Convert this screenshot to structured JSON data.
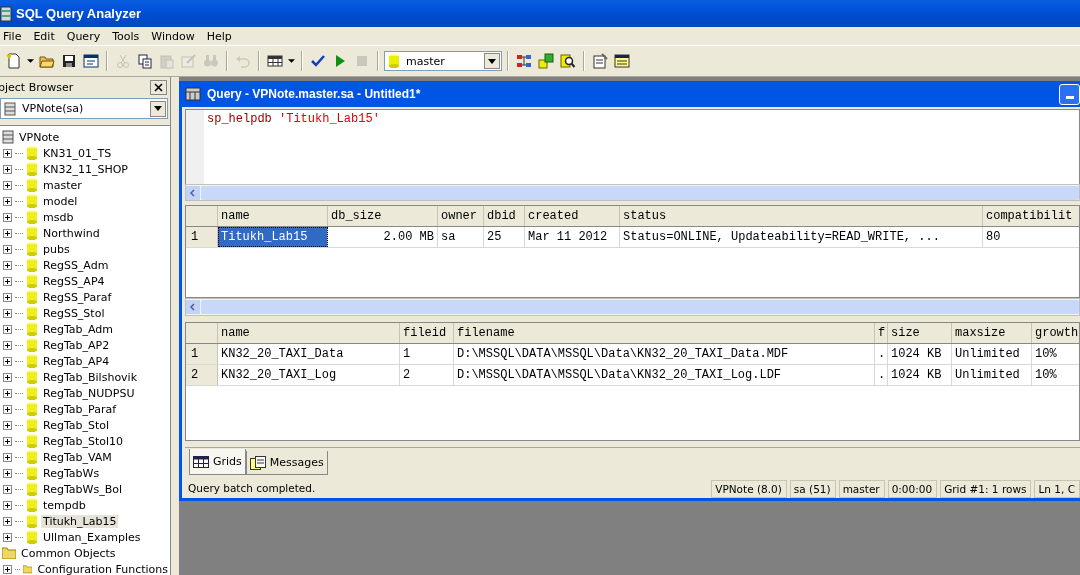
{
  "window": {
    "title": "SQL Query Analyzer"
  },
  "menu": [
    "File",
    "Edit",
    "Query",
    "Tools",
    "Window",
    "Help"
  ],
  "toolbar": [
    {
      "buttons": [
        {
          "kind": "new",
          "disabled": false
        },
        {
          "kind": "caret",
          "disabled": false
        },
        {
          "kind": "open",
          "disabled": false
        },
        {
          "kind": "save",
          "disabled": false
        },
        {
          "kind": "template",
          "disabled": false
        }
      ]
    },
    {
      "buttons": [
        {
          "kind": "cut",
          "disabled": true
        },
        {
          "kind": "copy",
          "disabled": false
        },
        {
          "kind": "paste",
          "disabled": true
        },
        {
          "kind": "edit",
          "disabled": true
        },
        {
          "kind": "find",
          "disabled": true
        }
      ]
    },
    {
      "buttons": [
        {
          "kind": "undo",
          "disabled": true
        }
      ]
    },
    {
      "buttons": [
        {
          "kind": "grid",
          "disabled": false
        },
        {
          "kind": "caret",
          "disabled": false
        }
      ]
    },
    {
      "buttons": [
        {
          "kind": "check",
          "disabled": false
        },
        {
          "kind": "run",
          "disabled": false
        },
        {
          "kind": "stop",
          "disabled": true
        }
      ]
    },
    {
      "buttons": [
        {
          "kind": "plan",
          "disabled": false
        },
        {
          "kind": "objects",
          "disabled": false
        },
        {
          "kind": "search",
          "disabled": false
        }
      ]
    },
    {
      "buttons": [
        {
          "kind": "options",
          "disabled": false
        },
        {
          "kind": "results",
          "disabled": false
        }
      ]
    }
  ],
  "database_select": {
    "value": "master"
  },
  "object_browser": {
    "title": "bject Browser",
    "server_select": {
      "value": "VPNote(sa)"
    },
    "tree": [
      {
        "label": "VPNote",
        "kind": "server",
        "children": [
          {
            "label": "KN31_01_TS",
            "kind": "database",
            "expanded": false,
            "selected": false
          },
          {
            "label": "KN32_11_SHOP",
            "kind": "database",
            "expanded": false,
            "selected": false
          },
          {
            "label": "master",
            "kind": "database",
            "expanded": false,
            "selected": false
          },
          {
            "label": "model",
            "kind": "database",
            "expanded": false,
            "selected": false
          },
          {
            "label": "msdb",
            "kind": "database",
            "expanded": false,
            "selected": false
          },
          {
            "label": "Northwind",
            "kind": "database",
            "expanded": false,
            "selected": false
          },
          {
            "label": "pubs",
            "kind": "database",
            "expanded": false,
            "selected": false
          },
          {
            "label": "RegSS_Adm",
            "kind": "database",
            "expanded": false,
            "selected": false
          },
          {
            "label": "RegSS_AP4",
            "kind": "database",
            "expanded": false,
            "selected": false
          },
          {
            "label": "RegSS_Paraf",
            "kind": "database",
            "expanded": false,
            "selected": false
          },
          {
            "label": "RegSS_Stol",
            "kind": "database",
            "expanded": false,
            "selected": false
          },
          {
            "label": "RegTab_Adm",
            "kind": "database",
            "expanded": false,
            "selected": false
          },
          {
            "label": "RegTab_AP2",
            "kind": "database",
            "expanded": false,
            "selected": false
          },
          {
            "label": "RegTab_AP4",
            "kind": "database",
            "expanded": false,
            "selected": false
          },
          {
            "label": "RegTab_Bilshovik",
            "kind": "database",
            "expanded": false,
            "selected": false
          },
          {
            "label": "RegTab_NUDPSU",
            "kind": "database",
            "expanded": false,
            "selected": false
          },
          {
            "label": "RegTab_Paraf",
            "kind": "database",
            "expanded": false,
            "selected": false
          },
          {
            "label": "RegTab_Stol",
            "kind": "database",
            "expanded": false,
            "selected": false
          },
          {
            "label": "RegTab_Stol10",
            "kind": "database",
            "expanded": false,
            "selected": false
          },
          {
            "label": "RegTab_VAM",
            "kind": "database",
            "expanded": false,
            "selected": false
          },
          {
            "label": "RegTabWs",
            "kind": "database",
            "expanded": false,
            "selected": false
          },
          {
            "label": "RegTabWs_Bol",
            "kind": "database",
            "expanded": false,
            "selected": false
          },
          {
            "label": "tempdb",
            "kind": "database",
            "expanded": false,
            "selected": false
          },
          {
            "label": "Titukh_Lab15",
            "kind": "database",
            "expanded": false,
            "selected": true
          },
          {
            "label": "Ullman_Examples",
            "kind": "database",
            "expanded": false,
            "selected": false
          }
        ]
      },
      {
        "label": "Common Objects",
        "kind": "folder",
        "children": [
          {
            "label": "Configuration Functions",
            "kind": "folder",
            "expanded": false,
            "selected": false
          }
        ]
      }
    ]
  },
  "query_window": {
    "title": "Query - VPNote.master.sa - Untitled1*",
    "editor": [
      {
        "text": "sp_helpdb",
        "kind": "keyword"
      },
      {
        "text": " 'Titukh_Lab15'",
        "kind": "string"
      }
    ],
    "grids": [
      {
        "columns": [
          "name",
          "db_size",
          "owner",
          "dbid",
          "created",
          "status",
          "compatibilit"
        ],
        "rows": [
          {
            "number": "1",
            "cells": [
              {
                "text": "Titukh_Lab15",
                "selected": true
              },
              {
                "text": "2.00 MB",
                "selected": false
              },
              {
                "text": "sa",
                "selected": false
              },
              {
                "text": "25",
                "selected": false
              },
              {
                "text": "Mar 11 2012",
                "selected": false
              },
              {
                "text": "Status=ONLINE, Updateability=READ_WRITE, ...",
                "selected": false
              },
              {
                "text": "80",
                "selected": false
              }
            ]
          }
        ]
      },
      {
        "columns": [
          "name",
          "fileid",
          "filename",
          "f",
          "size",
          "maxsize",
          "growth"
        ],
        "rows": [
          {
            "number": "1",
            "cells": [
              {
                "text": "KN32_20_TAXI_Data",
                "selected": false
              },
              {
                "text": "1",
                "selected": false
              },
              {
                "text": "D:\\MSSQL\\DATA\\MSSQL\\Data\\KN32_20_TAXI_Data.MDF",
                "selected": false
              },
              {
                "text": ".",
                "selected": false
              },
              {
                "text": "1024 KB",
                "selected": false
              },
              {
                "text": "Unlimited",
                "selected": false
              },
              {
                "text": "10%",
                "selected": false
              }
            ]
          },
          {
            "number": "2",
            "cells": [
              {
                "text": "KN32_20_TAXI_Log",
                "selected": false
              },
              {
                "text": "2",
                "selected": false
              },
              {
                "text": "D:\\MSSQL\\DATA\\MSSQL\\Data\\KN32_20_TAXI_Log.LDF",
                "selected": false
              },
              {
                "text": ".",
                "selected": false
              },
              {
                "text": "1024 KB",
                "selected": false
              },
              {
                "text": "Unlimited",
                "selected": false
              },
              {
                "text": "10%",
                "selected": false
              }
            ]
          }
        ]
      }
    ],
    "tabs": [
      {
        "label": "Grids",
        "kind": "grid",
        "selected": true
      },
      {
        "label": "Messages",
        "kind": "messages",
        "selected": false
      }
    ],
    "status_bar": [
      "Query batch completed.",
      "VPNote (8.0)",
      "sa (51)",
      "master",
      "0:00:00",
      "Grid #1: 1 rows",
      "Ln 1, C"
    ]
  }
}
